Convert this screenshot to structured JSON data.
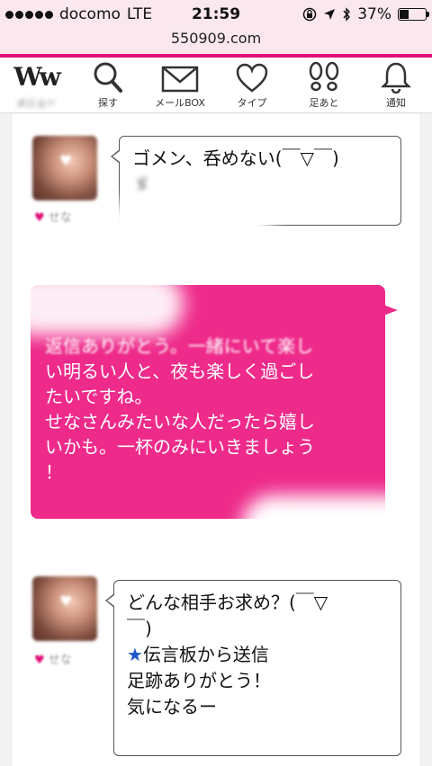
{
  "status_bar": {
    "carrier": "docomo",
    "network": "LTE",
    "time": "21:59",
    "battery": "37%",
    "battery_level": 0.37
  },
  "url": "550909.com",
  "nav": [
    {
      "label": "メニュー",
      "icon": "ww-logo-icon"
    },
    {
      "label": "探す",
      "icon": "search-icon"
    },
    {
      "label": "メールBOX",
      "icon": "mail-icon"
    },
    {
      "label": "タイプ",
      "icon": "heart-icon"
    },
    {
      "label": "足あと",
      "icon": "footprints-icon"
    },
    {
      "label": "通知",
      "icon": "bell-icon"
    }
  ],
  "nav_logo_text": "Ww",
  "messages": {
    "m1": {
      "sender": "せな",
      "lines": [
        "ゴメン、呑めない(￣▽￣)",
        "ゞ"
      ]
    },
    "m2": {
      "lines": [
        "返信ありがとう。一緒にいて楽し",
        "い明るい人と、夜も楽しく過ごし",
        "たいですね。",
        "せなさんみたいな人だったら嬉し",
        "いかも。一杯のみにいきましょう",
        "！"
      ]
    },
    "m3": {
      "sender": "せな",
      "lines": [
        "どんな相手お求め？(￣▽",
        "￣)"
      ],
      "star": "★",
      "line_star": "伝言板から送信",
      "lines_after": [
        "足跡ありがとう！",
        "気になるー"
      ]
    }
  },
  "colors": {
    "accent": "#e0107a",
    "bubble_out": "#ee2a8a",
    "status_bg": "#fbe7ee",
    "star": "#1e55c9"
  }
}
